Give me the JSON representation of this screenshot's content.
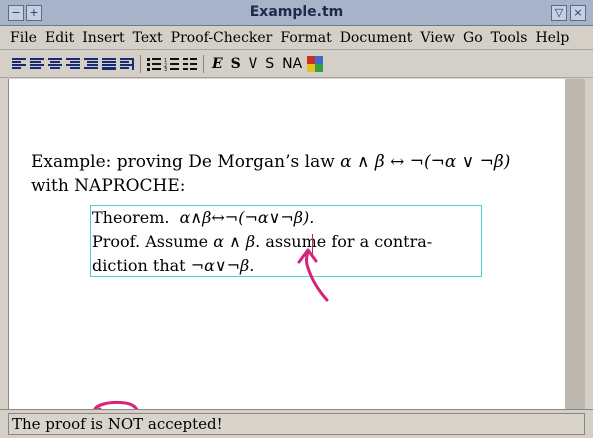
{
  "window": {
    "title": "Example.tm",
    "left_buttons": [
      "minimize-icon",
      "maximize-icon"
    ],
    "right_buttons": [
      "collapse-icon",
      "close-icon"
    ]
  },
  "menu": [
    "File",
    "Edit",
    "Insert",
    "Text",
    "Proof-Checker",
    "Format",
    "Document",
    "View",
    "Go",
    "Tools",
    "Help"
  ],
  "toolbar": {
    "align_icons": [
      "align-left-icon",
      "align-center-icon",
      "align-justify-icon",
      "align-right-icon",
      "indent-icon",
      "outdent-icon",
      "align-block-icon"
    ],
    "list_icons": [
      "bullet-list-icon",
      "numbered-list-icon",
      "description-list-icon"
    ],
    "style_buttons": {
      "emphasis": "E",
      "strong": "S",
      "verbatim": "V",
      "sans": "S",
      "name": "NA"
    },
    "color_icon": "color-palette-icon"
  },
  "document": {
    "intro_line1_text": "Example: proving De Morgan’s law ",
    "intro_line1_math": "α ∧ β ↔ ¬(¬α ∨ ¬β)",
    "intro_line2": "with NAPROCHE:",
    "theorem_label": "Theorem.",
    "theorem_math": "α∧β↔¬(¬α∨¬β).",
    "proof_line1_text": "Proof.  Assume ",
    "proof_line1_math": "α ∧ β",
    "proof_line1_rest": ".  assume for a contra-",
    "proof_line2_text": "diction that ",
    "proof_line2_math": "¬α∨¬β",
    "proof_line2_end": "."
  },
  "status": {
    "message": "The proof is NOT accepted!"
  },
  "colors": {
    "annotation": "#d6247a",
    "theorem_border": "#4fd0d8",
    "titlebar": "#a6b3c9"
  }
}
